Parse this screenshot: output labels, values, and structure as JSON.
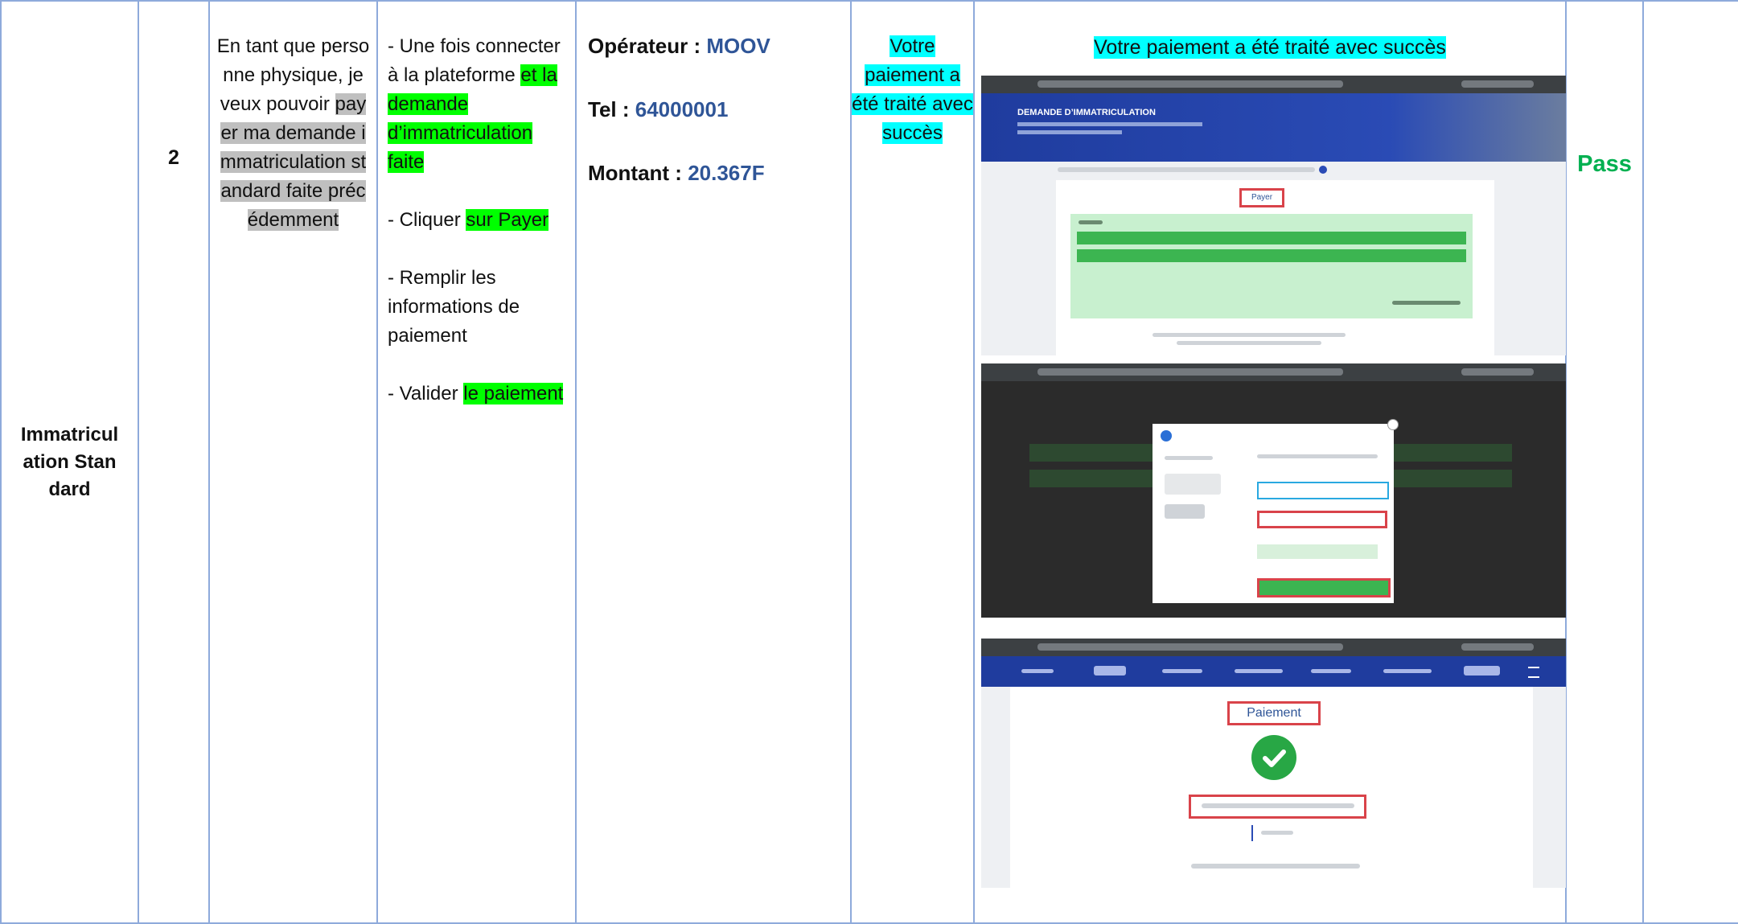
{
  "row": {
    "category": "Immatriculation Standard",
    "number": "2",
    "story": {
      "intro": "En tant que personne physique, je veux pouvoir",
      "highlighted": "payer ma demande immatriculation standard faite précédemment"
    },
    "steps": [
      {
        "plain": "- Une fois connecter à la plateforme ",
        "highlighted": "et la demande d’immatriculation faite"
      },
      {
        "plain": "- Cliquer ",
        "highlighted": "sur Payer"
      },
      {
        "plain": "-  Remplir les informations de paiement",
        "highlighted": ""
      },
      {
        "plain": "- Valider ",
        "highlighted": "le paiement"
      }
    ],
    "data": {
      "operator_label": "Opérateur : ",
      "operator_value": "MOOV",
      "tel_label": "Tel : ",
      "tel_value": "64000001",
      "amount_label": "Montant : ",
      "amount_value": "20.367F"
    },
    "expected": "Votre paiement a été traité avec succès",
    "screenshot_caption": "Votre paiement a été traité avec succès",
    "status": "Pass"
  },
  "screenshots": {
    "shot1": {
      "page_title": "DEMANDE D’IMMATRICULATION",
      "button": "Payer"
    },
    "shot3": {
      "title": "Paiement"
    }
  },
  "colors": {
    "border": "#8eaadb",
    "highlight_green": "#00ff00",
    "highlight_cyan": "#00ffff",
    "highlight_gray": "#bfbfbf",
    "value_blue": "#2f5597",
    "pass_green": "#00b050",
    "nav_blue": "#1f3c9e"
  }
}
